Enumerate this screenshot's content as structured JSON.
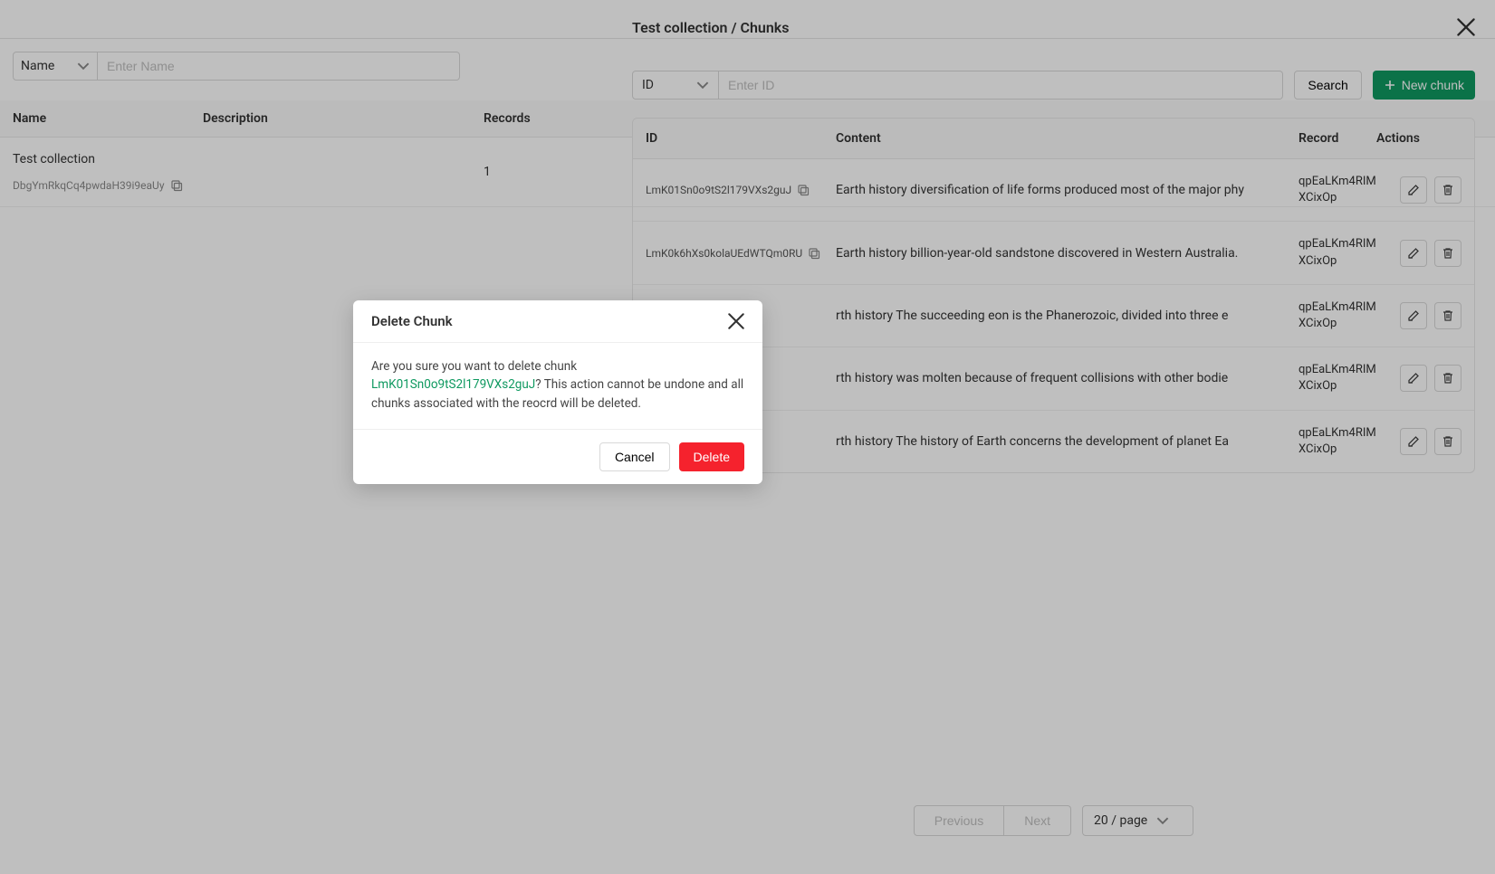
{
  "bg": {
    "filter_select": "Name",
    "filter_placeholder": "Enter Name",
    "cols": {
      "name": "Name",
      "desc": "Description",
      "rec": "Records"
    },
    "row": {
      "name": "Test collection",
      "id": "DbgYmRkqCq4pwdaH39i9eaUy",
      "records": "1"
    }
  },
  "drawer": {
    "title": "Test collection / Chunks",
    "filter_select": "ID",
    "filter_placeholder": "Enter ID",
    "search_label": "Search",
    "new_label": "New chunk",
    "cols": {
      "id": "ID",
      "content": "Content",
      "record": "Record",
      "actions": "Actions"
    },
    "rows": [
      {
        "id": "LmK01Sn0o9tS2l179VXs2guJ",
        "content": "Earth history diversification of life forms produced most of the major phy",
        "record": "qpEaLKm4RIMXCixOp"
      },
      {
        "id": "LmK0k6hXs0kolaUEdWTQm0RU",
        "content": "Earth history billion-year-old sandstone discovered in Western Australia.",
        "record": "qpEaLKm4RIMXCixOp"
      },
      {
        "id": "",
        "content": "rth history The succeeding eon is the Phanerozoic, divided into three e",
        "record": "qpEaLKm4RIMXCixOp"
      },
      {
        "id": "",
        "content": "rth history was molten because of frequent collisions with other bodie",
        "record": "qpEaLKm4RIMXCixOp"
      },
      {
        "id": "",
        "content": "rth history The history of Earth concerns the development of planet Ea",
        "record": "qpEaLKm4RIMXCixOp"
      }
    ],
    "pagination": {
      "prev": "Previous",
      "next": "Next",
      "page_size": "20 / page"
    }
  },
  "modal": {
    "title": "Delete Chunk",
    "body_prefix": "Are you sure you want to delete chunk ",
    "chunk_id": "LmK01Sn0o9tS2l179VXs2guJ",
    "body_suffix": "? This action cannot be undone and all chunks associated with the reocrd will be deleted.",
    "cancel": "Cancel",
    "delete": "Delete"
  }
}
